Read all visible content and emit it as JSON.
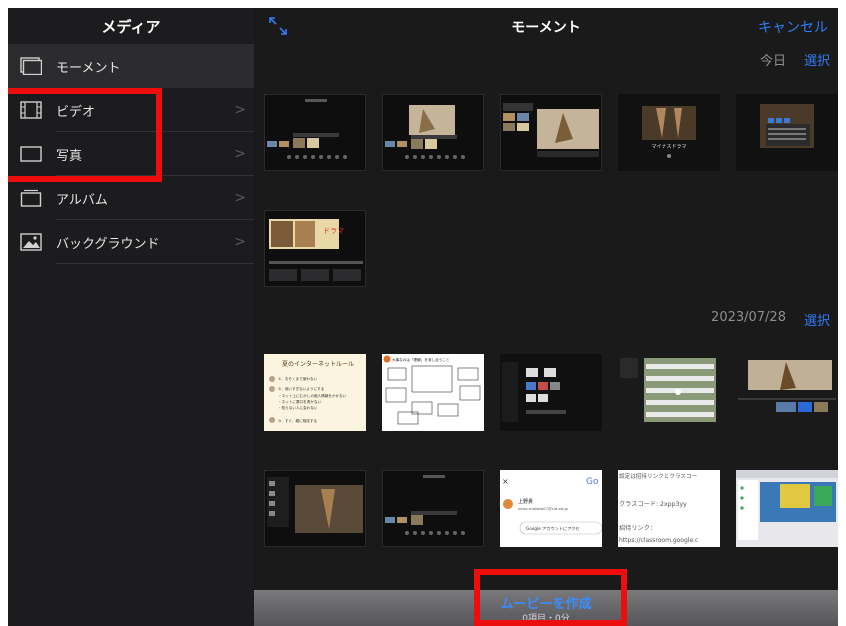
{
  "sidebar": {
    "title": "メディア",
    "items": [
      {
        "label": "モーメント",
        "icon": "stack-icon"
      },
      {
        "label": "ビデオ",
        "icon": "film-icon"
      },
      {
        "label": "写真",
        "icon": "photo-frame-icon"
      },
      {
        "label": "アルバム",
        "icon": "album-icon"
      },
      {
        "label": "バックグラウンド",
        "icon": "landscape-icon"
      }
    ],
    "chevron": ">"
  },
  "main": {
    "title": "モーメント",
    "cancel": "キャンセル",
    "sections": [
      {
        "date": "今日",
        "select": "選択"
      },
      {
        "date": "2023/07/28",
        "select": "選択"
      }
    ],
    "thumb_text": {
      "drama_a": "マイナスドラマ",
      "drama_b": "ドラマ",
      "internet_title": "夏のインターネットルール",
      "internet_lines": [
        "①、おそくまで使わない",
        "②、使いすぎないようにする",
        "・ネット上にむかしの個人情報をかかない",
        "・ネットに悪口を書かない",
        "・知らない人に会わない",
        "③、すぐ、親に相談する"
      ],
      "card_title": "大事なのは「理解」を深し合うこと",
      "google_letter": "Go",
      "google_name": "上野貴",
      "google_email": "ueno-makoto07@cid.ed.jp",
      "google_btn": "Google アカウントにアクセ",
      "classroom_line1": "設定は招待リンクとクラスコー",
      "classroom_code": "クラスコード: 2xpp3yy",
      "classroom_invite": "招待リンク：",
      "classroom_url": "https://classroom.google.c"
    }
  },
  "bottom": {
    "create": "ムービーを作成",
    "count": "0項目・0分"
  },
  "colors": {
    "accent": "#2f7cf6",
    "highlight": "#ee0d0d"
  }
}
